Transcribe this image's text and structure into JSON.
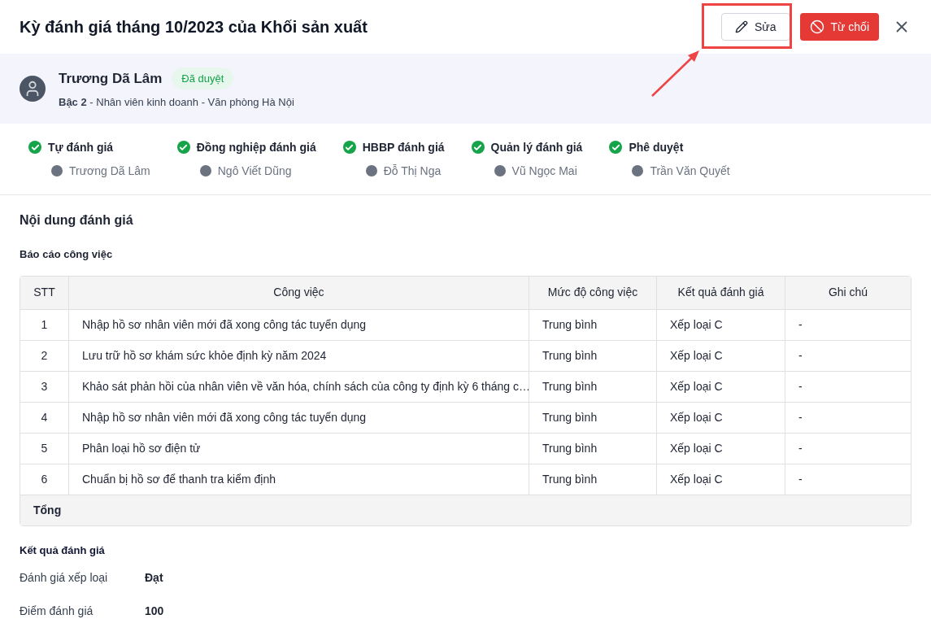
{
  "header": {
    "title": "Kỳ đánh giá tháng 10/2023 của Khối sản xuất",
    "edit_button": "Sửa",
    "reject_button": "Từ chối"
  },
  "annotation": {
    "highlight": true
  },
  "profile": {
    "name": "Trương Dã Lâm",
    "status": "Đã duyệt",
    "level": "Bậc 2",
    "details": " - Nhân viên kinh doanh - Văn phòng Hà Nội"
  },
  "steps": [
    {
      "label": "Tự đánh giá",
      "person": "Trương Dã Lâm",
      "done": true
    },
    {
      "label": "Đồng nghiệp đánh giá",
      "person": "Ngô Viết Dũng",
      "done": true
    },
    {
      "label": "HBBP đánh giá",
      "person": "Đỗ Thị Nga",
      "done": true
    },
    {
      "label": "Quản lý đánh giá",
      "person": "Vũ Ngọc Mai",
      "done": true
    },
    {
      "label": "Phê duyệt",
      "person": "Trần Văn Quyết",
      "done": true
    }
  ],
  "section_title": "Nội dung đánh giá",
  "report": {
    "title": "Báo cáo công việc",
    "columns": [
      "STT",
      "Công việc",
      "Mức độ công việc",
      "Kết quả đánh giá",
      "Ghi chú"
    ],
    "rows": [
      [
        "1",
        "Nhập hồ sơ nhân viên mới đã xong công tác tuyển dụng",
        "Trung bình",
        "Xếp loại C",
        "-"
      ],
      [
        "2",
        "Lưu trữ hồ sơ khám sức khỏe định kỳ năm 2024",
        "Trung bình",
        "Xếp loại C",
        "-"
      ],
      [
        "3",
        "Khảo sát phản hồi của nhân viên về văn hóa, chính sách của công ty định kỳ 6 tháng c…",
        "Trung bình",
        "Xếp loại C",
        "-"
      ],
      [
        "4",
        "Nhập hồ sơ nhân viên mới đã xong công tác tuyển dụng",
        "Trung bình",
        "Xếp loại C",
        "-"
      ],
      [
        "5",
        "Phân loại hồ sơ điện tử",
        "Trung bình",
        "Xếp loại C",
        "-"
      ],
      [
        "6",
        "Chuẩn bị hồ sơ để thanh tra kiểm định",
        "Trung bình",
        "Xếp loại C",
        "-"
      ]
    ],
    "total_label": "Tổng"
  },
  "result": {
    "title": "Kết quả đánh giá",
    "fields": [
      {
        "label": "Đánh giá xếp loại",
        "value": "Đạt"
      },
      {
        "label": "Điểm đánh giá",
        "value": "100"
      }
    ]
  }
}
